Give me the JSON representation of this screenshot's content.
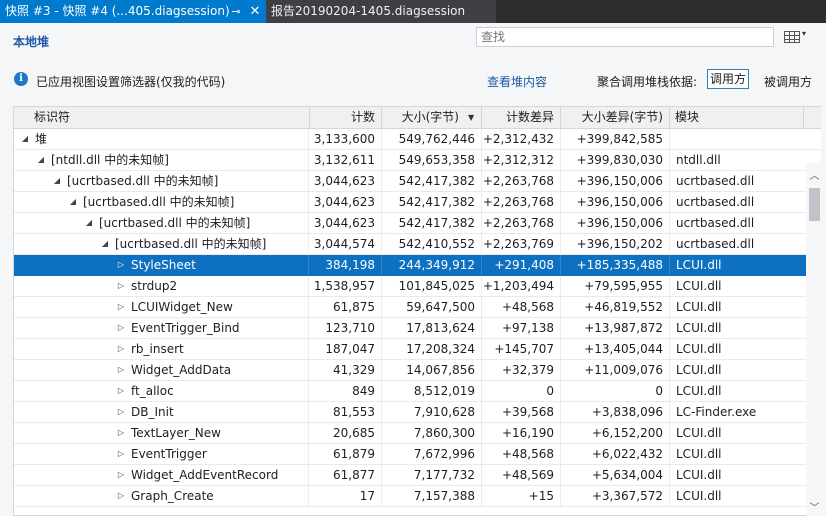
{
  "tabs": {
    "active_label": "快照 #3 - 快照 #4 (...405.diagsession)",
    "pin_glyph": "⊸",
    "close_glyph": "✕",
    "inactive_label": "报告20190204-1405.diagsession"
  },
  "toolbar": {
    "section_title": "本地堆",
    "search_placeholder": "查找",
    "view_caret": "▾"
  },
  "infobar": {
    "info_glyph": "i",
    "filter_text": "已应用视图设置筛选器(仅我的代码)",
    "view_heap_link": "查看堆内容",
    "aggregate_label": "聚合调用堆栈依据:",
    "callee_button": "调用方",
    "caller_button": "被调用方"
  },
  "columns": {
    "identifier": "标识符",
    "count": "计数",
    "size": "大小(字节)",
    "count_diff": "计数差异",
    "size_diff": "大小差异(字节)",
    "module": "模块",
    "sort_glyph": "▼"
  },
  "rows": [
    {
      "expander": "◢",
      "name": "堆",
      "count": "3,133,600",
      "size": "549,762,446",
      "count_diff": "+2,312,432",
      "size_diff": "+399,842,585",
      "module": ""
    },
    {
      "expander": "◢",
      "name": "[ntdll.dll 中的未知帧]",
      "count": "3,132,611",
      "size": "549,653,358",
      "count_diff": "+2,312,312",
      "size_diff": "+399,830,030",
      "module": "ntdll.dll"
    },
    {
      "expander": "◢",
      "name": "[ucrtbased.dll 中的未知帧]",
      "count": "3,044,623",
      "size": "542,417,382",
      "count_diff": "+2,263,768",
      "size_diff": "+396,150,006",
      "module": "ucrtbased.dll"
    },
    {
      "expander": "◢",
      "name": "[ucrtbased.dll 中的未知帧]",
      "count": "3,044,623",
      "size": "542,417,382",
      "count_diff": "+2,263,768",
      "size_diff": "+396,150,006",
      "module": "ucrtbased.dll"
    },
    {
      "expander": "◢",
      "name": "[ucrtbased.dll 中的未知帧]",
      "count": "3,044,623",
      "size": "542,417,382",
      "count_diff": "+2,263,768",
      "size_diff": "+396,150,006",
      "module": "ucrtbased.dll"
    },
    {
      "expander": "◢",
      "name": "[ucrtbased.dll 中的未知帧]",
      "count": "3,044,574",
      "size": "542,410,552",
      "count_diff": "+2,263,769",
      "size_diff": "+396,150,202",
      "module": "ucrtbased.dll"
    },
    {
      "expander": "▷",
      "name": "StyleSheet",
      "count": "384,198",
      "size": "244,349,912",
      "count_diff": "+291,408",
      "size_diff": "+185,335,488",
      "module": "LCUI.dll"
    },
    {
      "expander": "▷",
      "name": "strdup2",
      "count": "1,538,957",
      "size": "101,845,025",
      "count_diff": "+1,203,494",
      "size_diff": "+79,595,955",
      "module": "LCUI.dll"
    },
    {
      "expander": "▷",
      "name": "LCUIWidget_New",
      "count": "61,875",
      "size": "59,647,500",
      "count_diff": "+48,568",
      "size_diff": "+46,819,552",
      "module": "LCUI.dll"
    },
    {
      "expander": "▷",
      "name": "EventTrigger_Bind",
      "count": "123,710",
      "size": "17,813,624",
      "count_diff": "+97,138",
      "size_diff": "+13,987,872",
      "module": "LCUI.dll"
    },
    {
      "expander": "▷",
      "name": "rb_insert",
      "count": "187,047",
      "size": "17,208,324",
      "count_diff": "+145,707",
      "size_diff": "+13,405,044",
      "module": "LCUI.dll"
    },
    {
      "expander": "▷",
      "name": "Widget_AddData",
      "count": "41,329",
      "size": "14,067,856",
      "count_diff": "+32,379",
      "size_diff": "+11,009,076",
      "module": "LCUI.dll"
    },
    {
      "expander": "▷",
      "name": "ft_alloc",
      "count": "849",
      "size": "8,512,019",
      "count_diff": "0",
      "size_diff": "0",
      "module": "LCUI.dll"
    },
    {
      "expander": "▷",
      "name": "DB_Init",
      "count": "81,553",
      "size": "7,910,628",
      "count_diff": "+39,568",
      "size_diff": "+3,838,096",
      "module": "LC-Finder.exe"
    },
    {
      "expander": "▷",
      "name": "TextLayer_New",
      "count": "20,685",
      "size": "7,860,300",
      "count_diff": "+16,190",
      "size_diff": "+6,152,200",
      "module": "LCUI.dll"
    },
    {
      "expander": "▷",
      "name": "EventTrigger",
      "count": "61,879",
      "size": "7,672,996",
      "count_diff": "+48,568",
      "size_diff": "+6,022,432",
      "module": "LCUI.dll"
    },
    {
      "expander": "▷",
      "name": "Widget_AddEventRecord",
      "count": "61,877",
      "size": "7,177,732",
      "count_diff": "+48,569",
      "size_diff": "+5,634,004",
      "module": "LCUI.dll"
    },
    {
      "expander": "▷",
      "name": "Graph_Create",
      "count": "17",
      "size": "7,157,388",
      "count_diff": "+15",
      "size_diff": "+3,367,572",
      "module": "LCUI.dll"
    }
  ],
  "scrollbar": {
    "up_glyph": "︿",
    "down_glyph": "﹀"
  }
}
